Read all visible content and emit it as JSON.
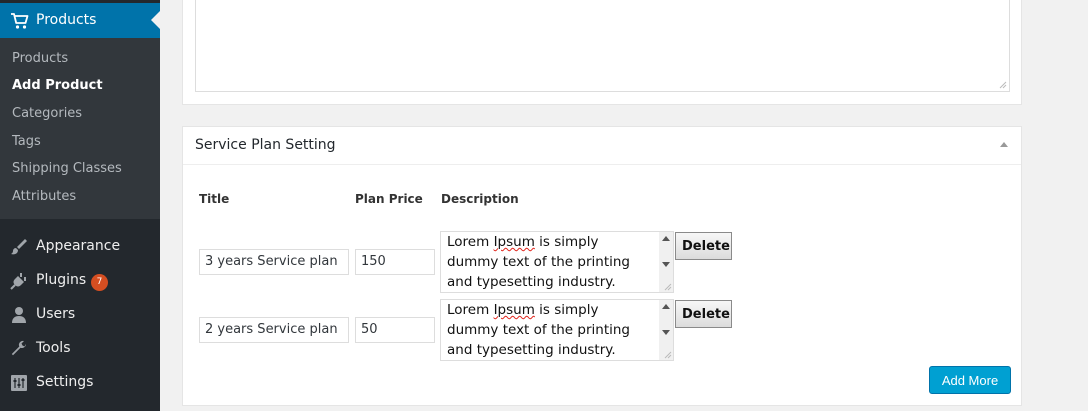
{
  "sidebar": {
    "active": {
      "label": "Products",
      "icon": "cart-icon"
    },
    "submenu": [
      "Products",
      "Add Product",
      "Categories",
      "Tags",
      "Shipping Classes",
      "Attributes"
    ],
    "current_submenu": "Add Product",
    "menu": [
      {
        "label": "Appearance",
        "icon": "paintbrush-icon"
      },
      {
        "label": "Plugins",
        "icon": "plugin-icon",
        "badge": "7"
      },
      {
        "label": "Users",
        "icon": "users-icon"
      },
      {
        "label": "Tools",
        "icon": "wrench-icon"
      },
      {
        "label": "Settings",
        "icon": "settings-icon"
      }
    ]
  },
  "service_plan": {
    "title": "Service Plan Setting",
    "columns": {
      "title": "Title",
      "price": "Plan Price",
      "description": "Description"
    },
    "rows": [
      {
        "title": "3 years Service plan",
        "price": "150",
        "description_word1": "Lorem",
        "description_word2": "Ipsum",
        "description_rest": " is simply dummy text of the printing and typesetting industry."
      },
      {
        "title": "2 years Service plan",
        "price": "50",
        "description_word1": "Lorem",
        "description_word2": "Ipsum",
        "description_rest": " is simply dummy text of the printing and typesetting industry."
      }
    ],
    "delete_label": "Delete",
    "add_more_label": "Add More"
  },
  "colors": {
    "sidebar_bg": "#23282d",
    "submenu_bg": "#32373c",
    "active_bg": "#0073aa",
    "badge_bg": "#d54e21",
    "button_primary": "#00a0d2"
  }
}
